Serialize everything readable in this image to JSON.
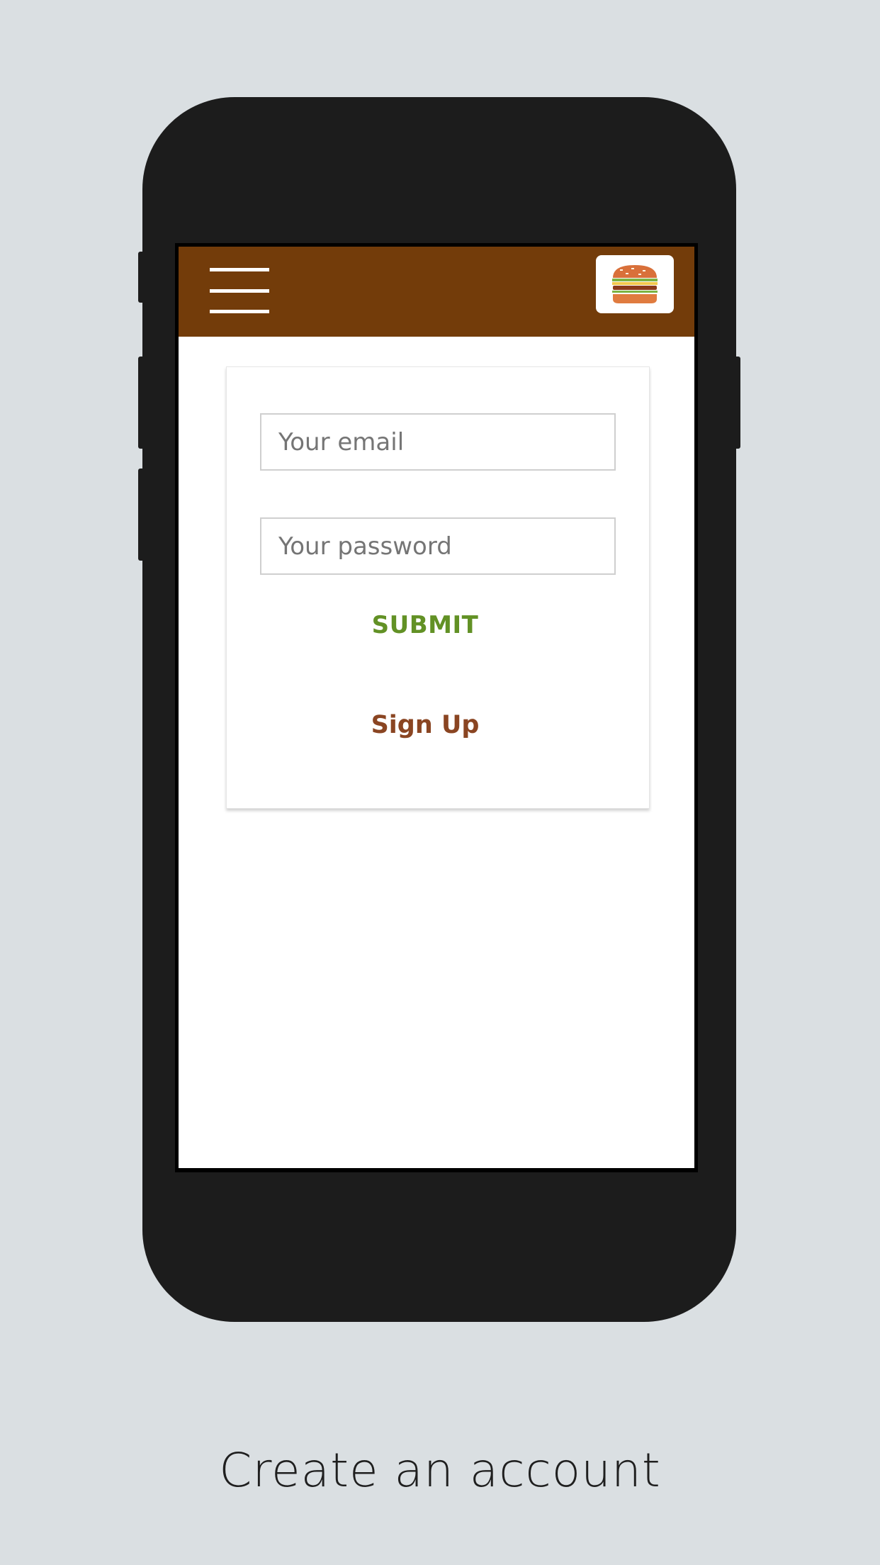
{
  "app": {
    "header_color": "#733c0a",
    "menu_icon": "hamburger-menu-icon",
    "logo_icon": "burger-logo-icon"
  },
  "form": {
    "email_placeholder": "Your email",
    "password_placeholder": "Your password",
    "submit_label": "SUBMIT",
    "signup_label": "Sign Up",
    "submit_color": "#629125",
    "signup_color": "#8a4522"
  },
  "caption": {
    "text": "Create an account"
  }
}
